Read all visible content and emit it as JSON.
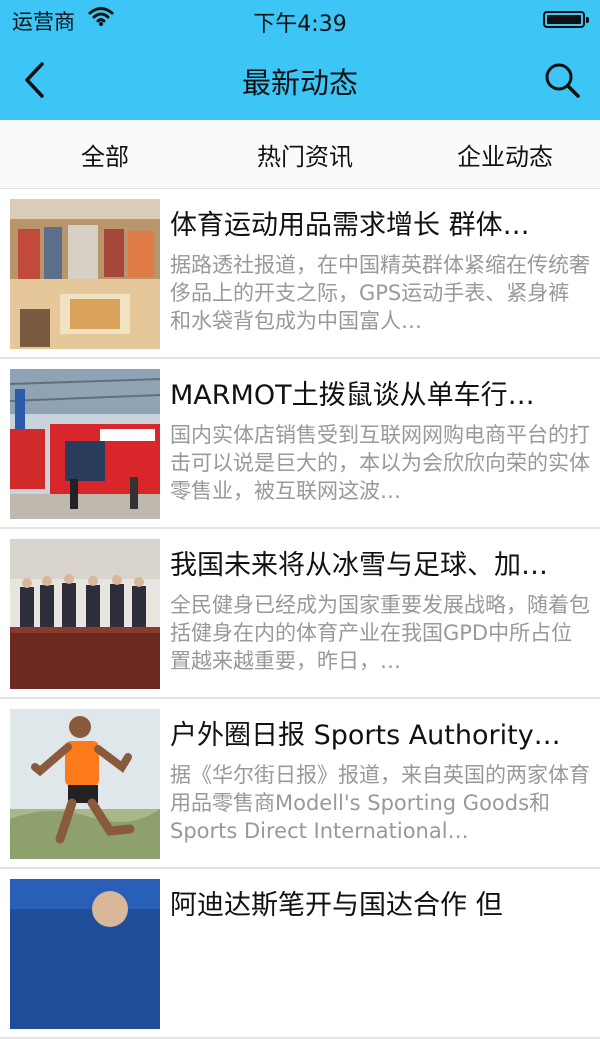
{
  "status_bar": {
    "carrier": "运营商",
    "time": "下午4:39"
  },
  "nav": {
    "title": "最新动态",
    "back_icon": "chevron-left-icon",
    "search_icon": "search-icon"
  },
  "tabs": [
    {
      "label": "全部"
    },
    {
      "label": "热门资讯"
    },
    {
      "label": "企业动态"
    }
  ],
  "articles": [
    {
      "title": "体育运动用品需求增长 群体…",
      "summary": "据路透社报道，在中国精英群体紧缩在传统奢侈品上的开支之际，GPS运动手表、紧身裤和水袋背包成为中国富人…"
    },
    {
      "title": "MARMOT土拨鼠谈从单车行…",
      "summary": "国内实体店销售受到互联网网购电商平台的打击可以说是巨大的，本以为会欣欣向荣的实体零售业，被互联网这波…"
    },
    {
      "title": "我国未来将从冰雪与足球、加…",
      "summary": "全民健身已经成为国家重要发展战略，随着包括健身在内的体育产业在我国GPD中所占位置越来越重要，昨日，…"
    },
    {
      "title": "户外圈日报 Sports Authority…",
      "summary": "据《华尔街日报》报道，来自英国的两家体育用品零售商Modell's Sporting Goods和Sports Direct International…"
    },
    {
      "title": "阿迪达斯笔开与国达合作 但",
      "summary": ""
    }
  ]
}
